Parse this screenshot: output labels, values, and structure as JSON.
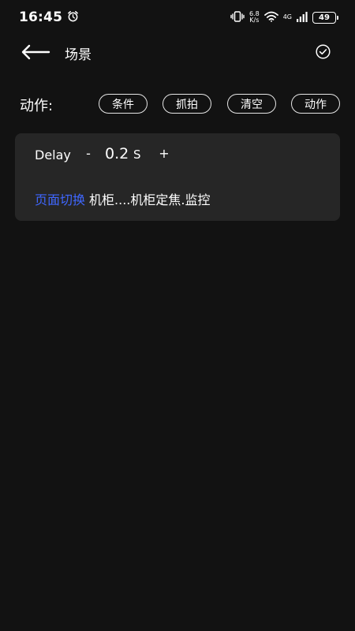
{
  "status_bar": {
    "time": "16:45",
    "net_speed_value": "6.8",
    "net_speed_unit": "K/s",
    "network_type": "4G",
    "battery": "49",
    "icons": [
      "alarm-icon",
      "vibrate-icon",
      "wifi-icon",
      "signal-icon",
      "battery-icon"
    ]
  },
  "appbar": {
    "title": "场景",
    "back_icon": "arrow-left-icon",
    "confirm_icon": "check-circle-icon"
  },
  "actions_bar": {
    "label": "动作:",
    "chips": [
      "条件",
      "抓拍",
      "清空",
      "动作"
    ]
  },
  "card": {
    "delay_label": "Delay",
    "minus_label": "-",
    "delay_value": "0.2",
    "delay_unit": "S",
    "plus_label": "+",
    "action_type": "页面切换",
    "action_detail": "机柜....机柜定焦.监控"
  },
  "colors": {
    "background": "#121212",
    "card_background": "#262626",
    "link": "#3f67ff",
    "text": "#ffffff"
  }
}
